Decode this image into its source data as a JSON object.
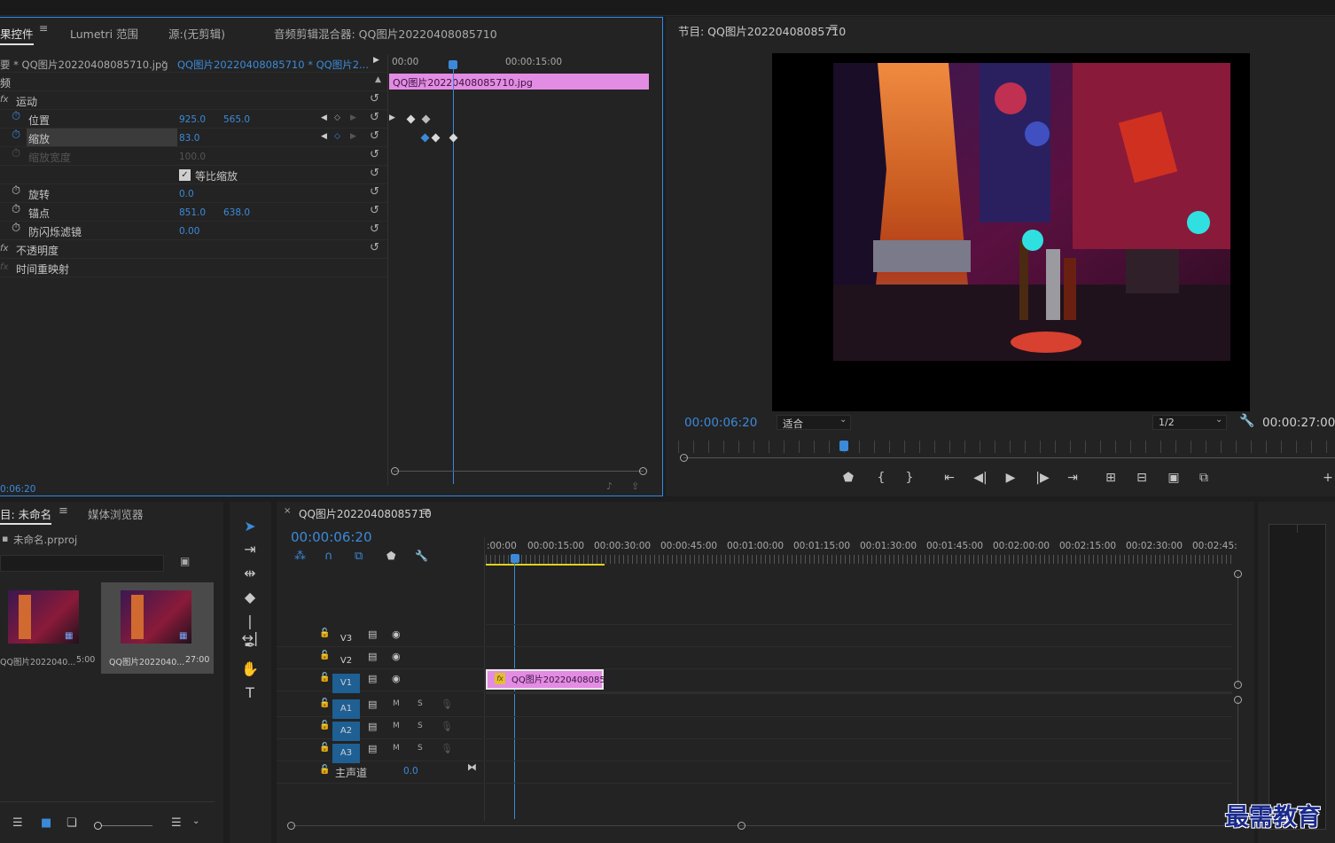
{
  "effect_controls": {
    "tabs": [
      "果控件",
      "Lumetri 范围",
      "源:(无剪辑)",
      "音频剪辑混合器: QQ图片20220408085710"
    ],
    "master_clip": "要 * QQ图片20220408085710.jpg",
    "sequence_clip": "QQ图片20220408085710 * QQ图片2...",
    "ruler": [
      "00:00",
      "00:00:15:00"
    ],
    "clip_bar": "QQ图片20220408085710.jpg",
    "section_video": "频",
    "motion": "运动",
    "position_label": "位置",
    "position_x": "925.0",
    "position_y": "565.0",
    "scale_label": "缩放",
    "scale_val": "83.0",
    "scale_width_label": "缩放宽度",
    "scale_width_val": "100.0",
    "uniform_label": "等比缩放",
    "rotation_label": "旋转",
    "rotation_val": "0.0",
    "anchor_label": "锚点",
    "anchor_x": "851.0",
    "anchor_y": "638.0",
    "flicker_label": "防闪烁滤镜",
    "flicker_val": "0.00",
    "opacity": "不透明度",
    "time_remap": "时间重映射",
    "timecode": "0:06:20"
  },
  "program": {
    "title": "节目: QQ图片20220408085710",
    "timecode": "00:00:06:20",
    "fit": "适合",
    "resolution": "1/2",
    "duration": "00:00:27:00"
  },
  "project": {
    "tabs": [
      "目: 未命名",
      "媒体浏览器"
    ],
    "file": "未命名.prproj",
    "items": [
      {
        "name": "QQ图片2022040...",
        "dur": "5:00"
      },
      {
        "name": "QQ图片2022040...",
        "dur": "27:00"
      }
    ]
  },
  "timeline": {
    "title": "QQ图片20220408085710",
    "timecode": "00:00:06:20",
    "ruler": [
      ":00:00",
      "00:00:15:00",
      "00:00:30:00",
      "00:00:45:00",
      "00:01:00:00",
      "00:01:15:00",
      "00:01:30:00",
      "00:01:45:00",
      "00:02:00:00",
      "00:02:15:00",
      "00:02:30:00",
      "00:02:45:"
    ],
    "tracks": [
      "V3",
      "V2",
      "V1",
      "A1",
      "A2",
      "A3"
    ],
    "m": "M",
    "s": "S",
    "master": "主声道",
    "master_val": "0.0",
    "clip": "QQ图片202204080857"
  },
  "watermark": "最需教育",
  "colors": {
    "accent": "#3b8ad9",
    "clip": "#e38ce3",
    "panel": "#232323"
  }
}
